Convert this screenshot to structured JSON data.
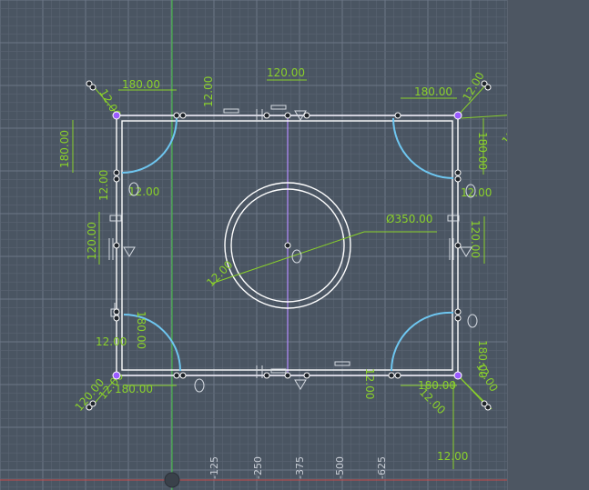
{
  "colors": {
    "background": "#4a5562",
    "grid_minor": "#5a6573",
    "grid_major": "#6c7787",
    "sketch_line": "#ffffff",
    "construction": "#b48cff",
    "dimension": "#8ad12a",
    "projected_arc": "#6ec6f0",
    "vertical_axis": "#3fbf3f",
    "horizontal_axis": "#c84b4b"
  },
  "dimensions": {
    "top_left_width": "180.00",
    "top_left_angle": "12.00",
    "top_center_width": "120.00",
    "top_inner_height": "12.00",
    "top_right_width": "180.00",
    "top_right_height": "12.00",
    "top_right_angle": "120.00",
    "left_height": "180.00",
    "left_inner": "12.00",
    "left_arc_offset": "12.00",
    "left_mid_height": "120.00",
    "circle_diameter": "Ø350.00",
    "circle_offset": "12.00",
    "right_height": "180.00",
    "right_mid_height": "120.00",
    "right_small": "12.00",
    "bottom_left_width": "180.00",
    "bottom_left_height": "180.00",
    "bottom_left_offset": "12.00",
    "bottom_left_angle": "120.00",
    "bottom_left_inner": "12.00",
    "bottom_center_height": "12.00",
    "bottom_right_width": "180.00",
    "bottom_right_height": "180.00",
    "bottom_right_angle": "12.00",
    "bottom_right_small": "12.00",
    "bottom_small": "12.00"
  },
  "axis_labels": [
    "-125",
    "-250",
    "-375",
    "-500",
    "-625"
  ]
}
